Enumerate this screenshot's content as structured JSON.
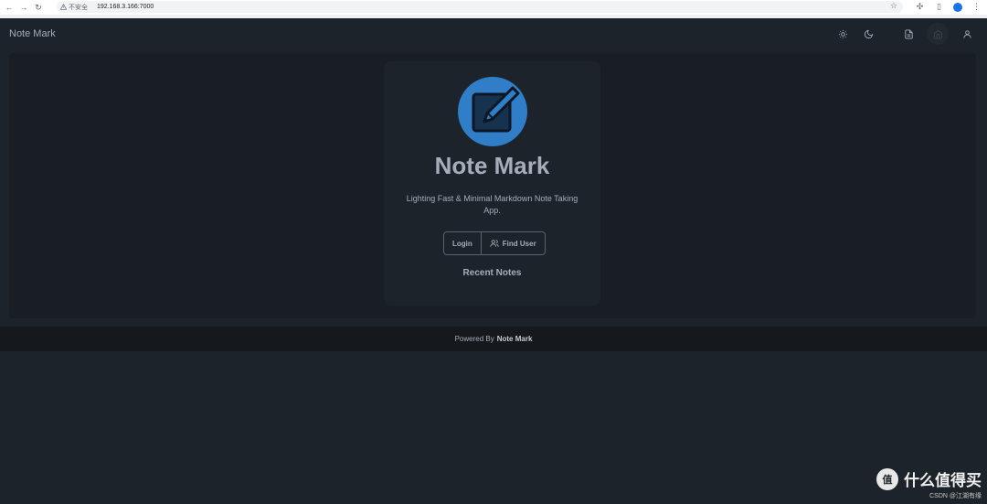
{
  "browser": {
    "security_label": "不安全",
    "url": "192.168.3.166:7000"
  },
  "header": {
    "brand": "Note Mark",
    "icons": [
      "sun-icon",
      "moon-icon",
      "document-icon",
      "home-icon",
      "user-icon"
    ]
  },
  "hero": {
    "title": "Note Mark",
    "tagline": "Lighting Fast & Minimal Markdown Note Taking App.",
    "login_label": "Login",
    "find_user_label": "Find User",
    "recent_notes_label": "Recent Notes"
  },
  "footer": {
    "prefix": "Powered By",
    "name": "Note Mark"
  },
  "watermark": {
    "logo_char": "值",
    "brand": "什么值得买",
    "credit": "CSDN @江湖有缘"
  },
  "colors": {
    "background": "#1d232a",
    "panel": "#191e24",
    "footer": "#15191e",
    "text": "#a6adbb",
    "logo_blue": "#2f7ec7"
  }
}
